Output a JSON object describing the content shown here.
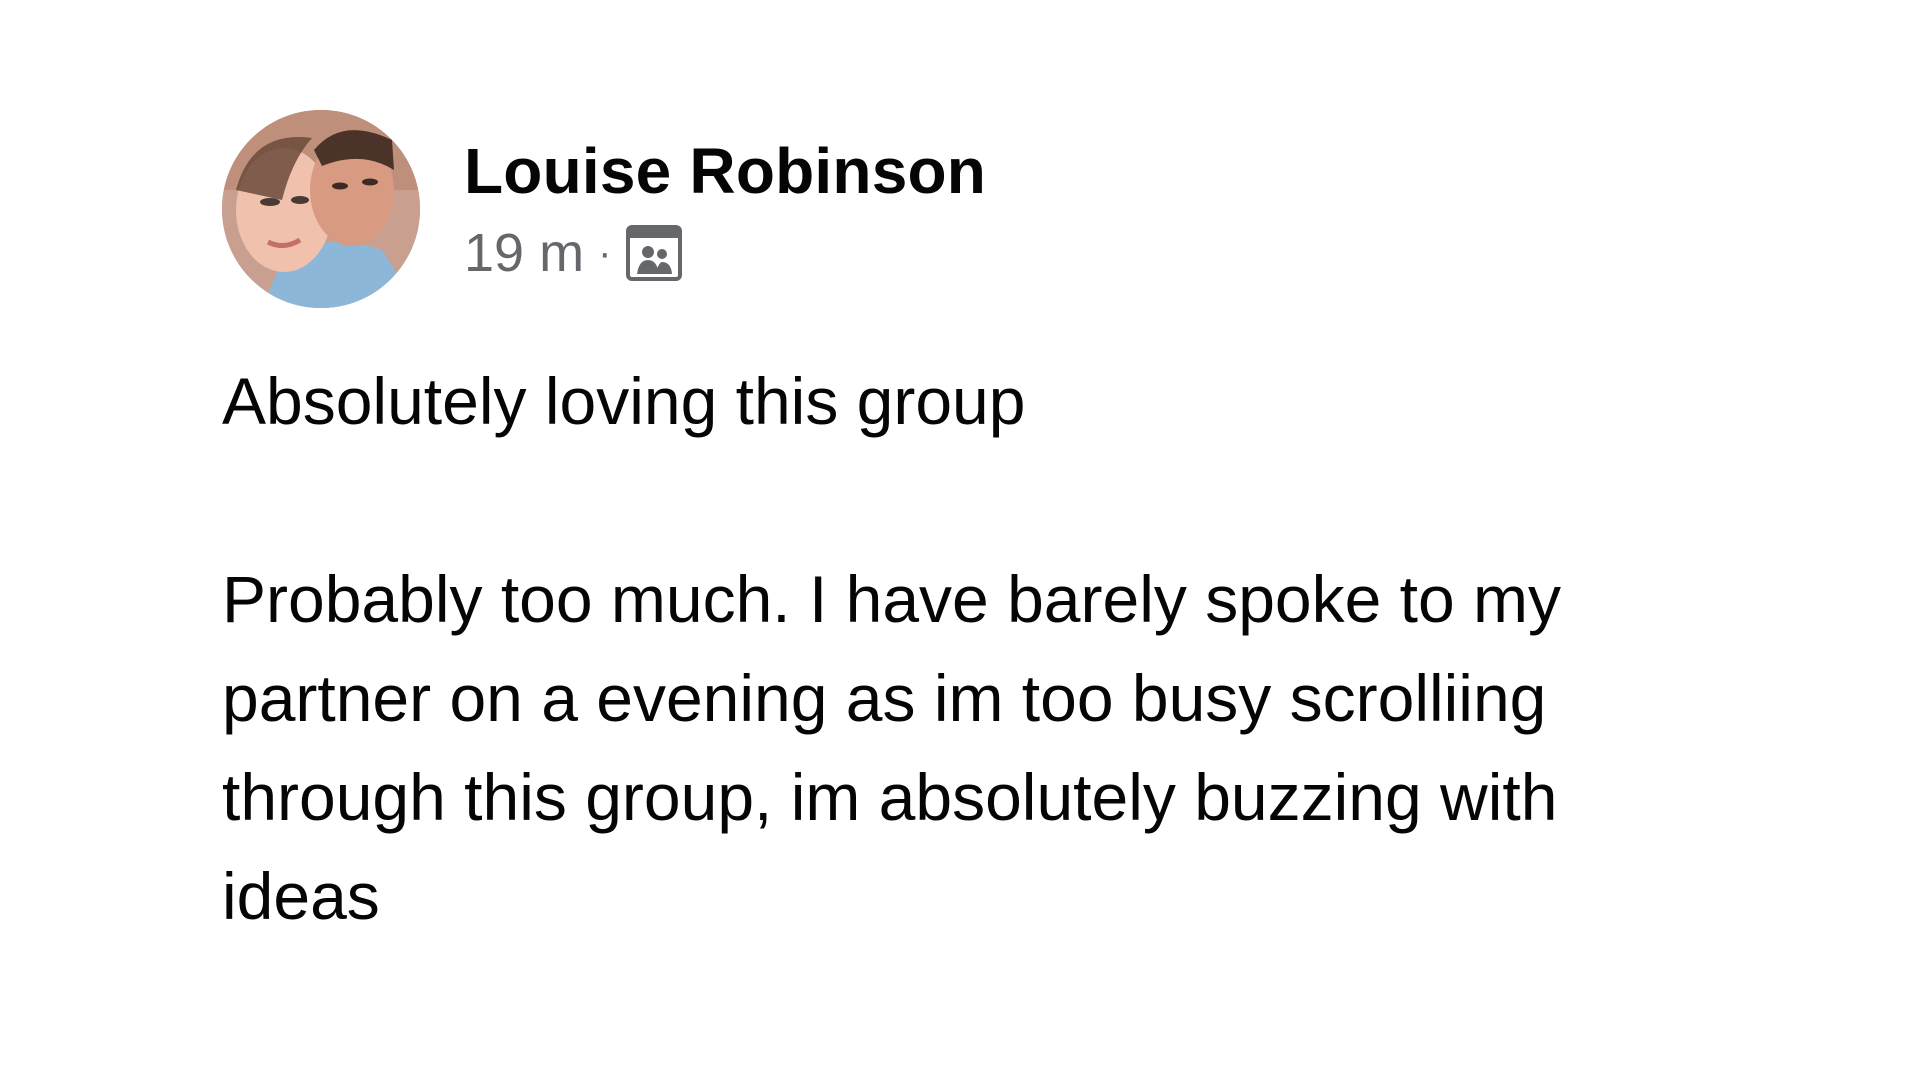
{
  "post": {
    "author": {
      "name": "Louise Robinson",
      "avatar_icon": "profile-photo"
    },
    "meta": {
      "timestamp": "19 m",
      "separator": "·",
      "audience_icon": "group-icon"
    },
    "body": {
      "paragraph_1": "Absolutely loving this group",
      "paragraph_2": "Probably too much. I have barely spoke to my partner on a evening as im too busy scrolliing through this group, im absolutely buzzing with ideas"
    }
  }
}
